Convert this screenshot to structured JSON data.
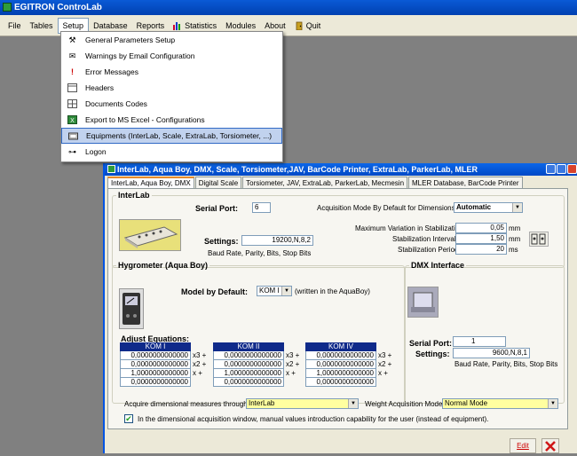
{
  "app": {
    "title": "EGITRON ControLab"
  },
  "menu": [
    "File",
    "Tables",
    "Setup",
    "Database",
    "Reports",
    "Statistics",
    "Modules",
    "About",
    "Quit"
  ],
  "setup_menu": [
    {
      "label": "General Parameters Setup",
      "icon": "tools-icon"
    },
    {
      "label": "Warnings by Email Configuration",
      "icon": "envelope-icon"
    },
    {
      "label": "Error Messages",
      "icon": "exclamation-icon"
    },
    {
      "label": "Headers",
      "icon": "header-icon"
    },
    {
      "label": "Documents Codes",
      "icon": "table-icon"
    },
    {
      "label": "Export to MS Excel - Configurations",
      "icon": "excel-icon"
    },
    {
      "label": "Equipments (InterLab, Scale, ExtraLab, Torsiometer, ...)",
      "icon": "monitor-icon",
      "selected": true
    },
    {
      "label": "Logon",
      "icon": "key-icon"
    }
  ],
  "dialog": {
    "title": "InterLab, Aqua Boy, DMX, Scale, Torsiometer,JAV, BarCode Printer, ExtraLab, ParkerLab, MLER",
    "tabs": [
      "InterLab, Aqua Boy, DMX",
      "Digital Scale",
      "Torsiometer, JAV, ExtraLab, ParkerLab, Mecmesin",
      "MLER Database, BarCode Printer"
    ],
    "interlab": {
      "legend": "InterLab",
      "serial_port_label": "Serial Port:",
      "serial_port_value": "6",
      "acq_mode_label": "Acquisition Mode By Default for Dimensions:",
      "acq_mode_value": "Automatic",
      "settings_label": "Settings:",
      "settings_value": "19200,N,8,2",
      "settings_hint": "Baud Rate, Parity, Bits, Stop Bits",
      "max_var_label": "Maximum Variation in Stabilization:",
      "max_var_value": "0,05",
      "max_var_unit": "mm",
      "stab_int_label": "Stabilization Interval:",
      "stab_int_value": "1,50",
      "stab_int_unit": "mm",
      "stab_per_label": "Stabilization Period:",
      "stab_per_value": "20",
      "stab_per_unit": "ms"
    },
    "hygrometer": {
      "legend": "Hygrometer (Aqua Boy)",
      "model_label": "Model by Default:",
      "model_value": "KOM I",
      "model_hint": "(written in the AquaBoy)",
      "adjust_label": "Adjust Equations:",
      "columns": [
        {
          "header": "KOM I",
          "values": [
            "0,0000000000000",
            "0,0000000000000",
            "1,0000000000000",
            "0,0000000000000"
          ]
        },
        {
          "header": "KOM II",
          "values": [
            "0,0000000000000",
            "0,0000000000000",
            "1,0000000000000",
            "0,0000000000000"
          ]
        },
        {
          "header": "KOM IV",
          "values": [
            "0,0000000000000",
            "0,0000000000000",
            "1,0000000000000",
            "0,0000000000000"
          ]
        }
      ],
      "row_suffixes": [
        "x3 +",
        "x2 +",
        "x +",
        ""
      ]
    },
    "dmx": {
      "legend": "DMX Interface",
      "serial_port_label": "Serial Port:",
      "serial_port_value": "1",
      "settings_label": "Settings:",
      "settings_value": "9600,N,8,1",
      "settings_hint": "Baud Rate, Parity, Bits, Stop Bits"
    },
    "acquire_label": "Acquire dimensional measures through:",
    "acquire_value": "InterLab",
    "weight_label": "Weight Acquisition Mode:",
    "weight_value": "Normal Mode",
    "checkbox_label": "In the dimensional acquisition window, manual values introduction capability for the user (instead of equipment).",
    "checkbox_checked": true,
    "edit_label": "Edit"
  }
}
